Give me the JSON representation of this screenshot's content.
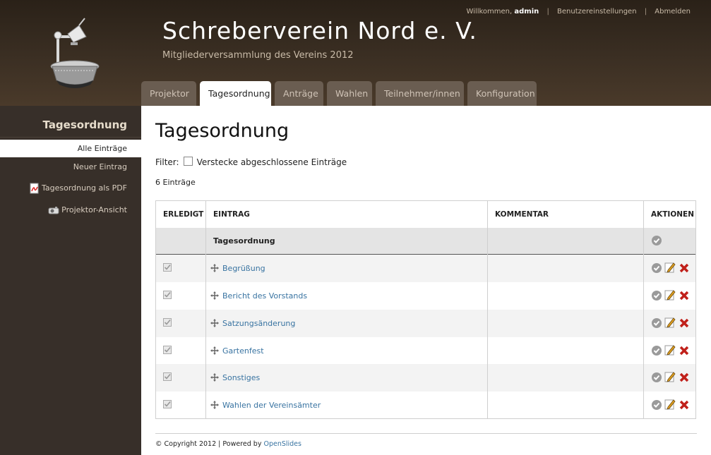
{
  "header": {
    "title": "Schreberverein Nord e. V.",
    "subtitle": "Mitgliederversammlung des Vereins 2012",
    "user_nav": {
      "welcome": "Willkommen,",
      "username": "admin",
      "separator": "|",
      "settings": "Benutzereinstellungen",
      "logout": "Abmelden"
    }
  },
  "tabs": [
    {
      "label": "Projektor"
    },
    {
      "label": "Tagesordnung",
      "active": true
    },
    {
      "label": "Anträge"
    },
    {
      "label": "Wahlen"
    },
    {
      "label": "Teilnehmer/innen"
    },
    {
      "label": "Konfiguration"
    }
  ],
  "sidebar": {
    "title": "Tagesordnung",
    "items": [
      {
        "label": "Alle Einträge",
        "active": true
      },
      {
        "label": "Neuer Eintrag"
      },
      {
        "label": "Tagesordnung als PDF",
        "icon": "pdf-icon"
      },
      {
        "label": "Projektor-Ansicht",
        "icon": "projector-icon"
      }
    ]
  },
  "main": {
    "page_title": "Tagesordnung",
    "filter_label": "Filter:",
    "filter_option": "Verstecke abgeschlossene Einträge",
    "count": "6 Einträge",
    "table": {
      "headers": [
        "ERLEDIGT",
        "EINTRAG",
        "KOMMENTAR",
        "AKTIONEN"
      ],
      "root_row": "Tagesordnung",
      "rows": [
        {
          "title": "Begrüßung",
          "comment": ""
        },
        {
          "title": "Bericht des Vorstands",
          "comment": ""
        },
        {
          "title": "Satzungsänderung",
          "comment": ""
        },
        {
          "title": "Gartenfest",
          "comment": ""
        },
        {
          "title": "Sonstiges",
          "comment": ""
        },
        {
          "title": "Wahlen der Vereinsämter",
          "comment": ""
        }
      ]
    }
  },
  "footer": {
    "copyright": "© Copyright 2012 | Powered by",
    "link": "OpenSlides"
  },
  "colors": {
    "header_bg": "#3b2f23",
    "sidebar_bg": "#372f29",
    "link": "#3873a1",
    "tab_inactive": "#6a5d51"
  }
}
